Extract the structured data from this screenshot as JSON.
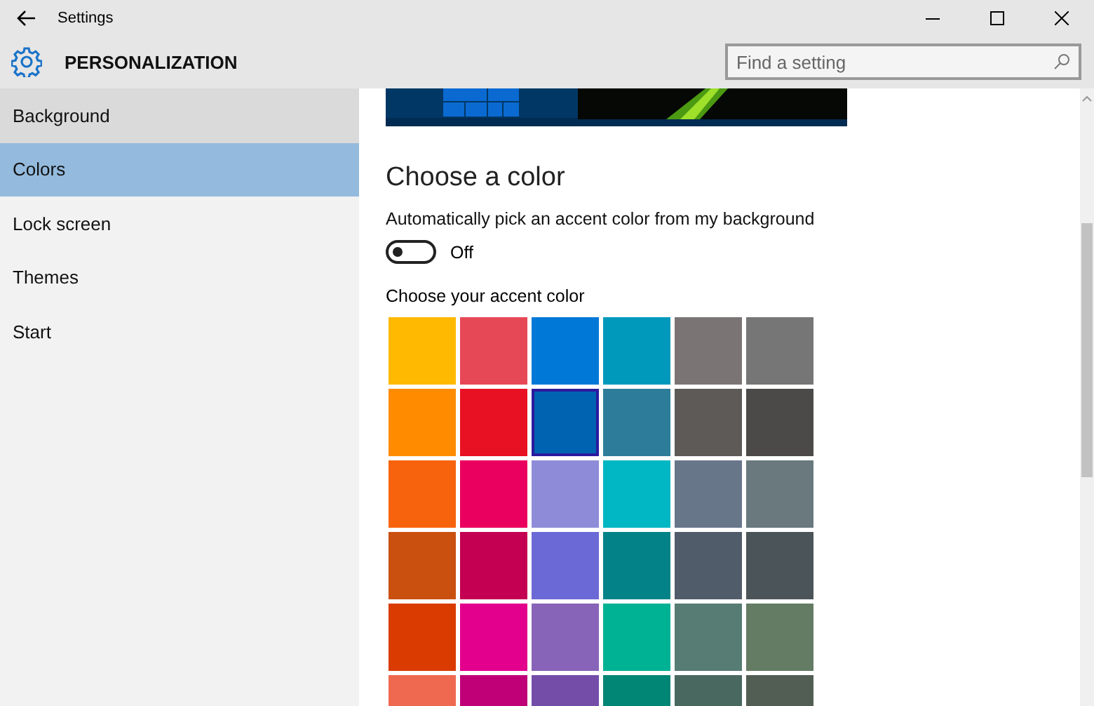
{
  "window": {
    "title": "Settings"
  },
  "header": {
    "title": "PERSONALIZATION",
    "search": {
      "placeholder": "Find a setting"
    }
  },
  "sidebar": {
    "items": [
      {
        "label": "Background",
        "selected": false,
        "hovered": true
      },
      {
        "label": "Colors",
        "selected": true,
        "hovered": false
      },
      {
        "label": "Lock screen",
        "selected": false,
        "hovered": false
      },
      {
        "label": "Themes",
        "selected": false,
        "hovered": false
      },
      {
        "label": "Start",
        "selected": false,
        "hovered": false
      }
    ]
  },
  "content": {
    "heading": "Choose a color",
    "auto_accent": {
      "label": "Automatically pick an accent color from my background",
      "on": false,
      "state_text": "Off"
    },
    "accent_label": "Choose your accent color",
    "swatches": [
      {
        "color": "#ffb900",
        "selected": false
      },
      {
        "color": "#e74856",
        "selected": false
      },
      {
        "color": "#0078d7",
        "selected": false
      },
      {
        "color": "#0099bc",
        "selected": false
      },
      {
        "color": "#7a7574",
        "selected": false
      },
      {
        "color": "#767676",
        "selected": false
      },
      {
        "color": "#ff8c00",
        "selected": false
      },
      {
        "color": "#e81123",
        "selected": false
      },
      {
        "color": "#0063b1",
        "selected": true
      },
      {
        "color": "#2d7d9a",
        "selected": false
      },
      {
        "color": "#5d5a58",
        "selected": false
      },
      {
        "color": "#4c4a48",
        "selected": false
      },
      {
        "color": "#f7630c",
        "selected": false
      },
      {
        "color": "#ea005e",
        "selected": false
      },
      {
        "color": "#8e8cd8",
        "selected": false
      },
      {
        "color": "#00b7c3",
        "selected": false
      },
      {
        "color": "#68768a",
        "selected": false
      },
      {
        "color": "#69797e",
        "selected": false
      },
      {
        "color": "#ca5010",
        "selected": false
      },
      {
        "color": "#c30052",
        "selected": false
      },
      {
        "color": "#6b69d6",
        "selected": false
      },
      {
        "color": "#038387",
        "selected": false
      },
      {
        "color": "#515c6b",
        "selected": false
      },
      {
        "color": "#4a5459",
        "selected": false
      },
      {
        "color": "#da3b01",
        "selected": false
      },
      {
        "color": "#e3008c",
        "selected": false
      },
      {
        "color": "#8764b8",
        "selected": false
      },
      {
        "color": "#00b294",
        "selected": false
      },
      {
        "color": "#567c73",
        "selected": false
      },
      {
        "color": "#647c64",
        "selected": false
      },
      {
        "color": "#ef6950",
        "selected": false
      },
      {
        "color": "#bf0077",
        "selected": false
      },
      {
        "color": "#744da9",
        "selected": false
      },
      {
        "color": "#018574",
        "selected": false
      },
      {
        "color": "#486860",
        "selected": false
      },
      {
        "color": "#525e54",
        "selected": false
      }
    ]
  }
}
